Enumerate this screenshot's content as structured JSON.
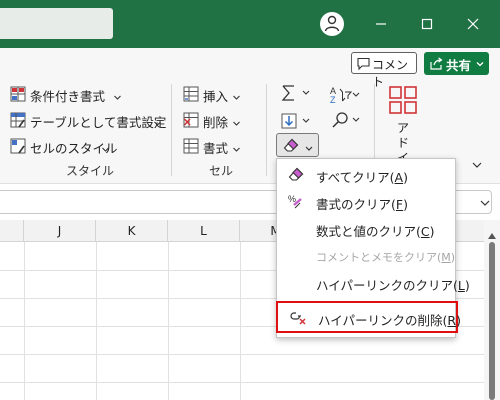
{
  "titlebar": {
    "search_placeholder": "",
    "colors": {
      "bar": "#207245",
      "text": "#ffffff"
    },
    "icons": [
      "account-icon",
      "minimize-icon",
      "restore-icon",
      "close-icon"
    ]
  },
  "header_buttons": {
    "comment_label": "コメント",
    "share_label": "共有"
  },
  "ribbon": {
    "styles_group": {
      "label": "スタイル",
      "items": [
        {
          "label": "条件付き書式",
          "icon": "conditional-format-icon"
        },
        {
          "label": "テーブルとして書式設定",
          "icon": "table-format-icon"
        },
        {
          "label": "セルのスタイル",
          "icon": "cell-style-icon"
        }
      ]
    },
    "cells_group": {
      "label": "セル",
      "items": [
        {
          "label": "挿入",
          "icon": "insert-cells-icon"
        },
        {
          "label": "削除",
          "icon": "delete-cells-icon"
        },
        {
          "label": "書式",
          "icon": "format-cells-icon"
        }
      ]
    },
    "editing_group": {
      "icons": [
        "autosum-icon",
        "fill-icon",
        "clear-eraser-icon",
        "sort-filter-icon",
        "find-icon"
      ]
    },
    "addin": {
      "label_line1": "アド",
      "label_line2": "イン",
      "icon": "addin-grid-icon"
    }
  },
  "grid": {
    "columns": [
      "J",
      "K",
      "L",
      "M"
    ]
  },
  "clear_menu": {
    "items": [
      {
        "label": "すべてクリア",
        "key": "A",
        "icon": "eraser-icon",
        "enabled": true
      },
      {
        "label": "書式のクリア",
        "key": "F",
        "icon": "clear-format-icon",
        "enabled": true
      },
      {
        "label": "数式と値のクリア",
        "key": "C",
        "icon": "",
        "enabled": true
      },
      {
        "label": "コメントとメモをクリア",
        "key": "M",
        "icon": "",
        "enabled": false
      },
      {
        "label": "ハイパーリンクのクリア",
        "key": "L",
        "icon": "",
        "enabled": true
      },
      {
        "label": "ハイパーリンクの削除",
        "key": "R",
        "icon": "remove-hyperlink-icon",
        "enabled": true,
        "highlighted": true
      }
    ],
    "highlight_color": "#e01010"
  }
}
